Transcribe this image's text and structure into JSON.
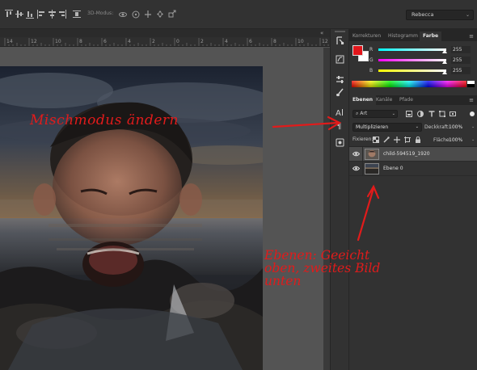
{
  "options_bar": {
    "mode_3d_label": "3D-Modus:",
    "workspace": "Rebecca",
    "icons": [
      "align-top-icon",
      "align-vcenter-icon",
      "align-bottom-icon",
      "align-left-icon",
      "align-hcenter-icon",
      "align-right-icon",
      "distribute-icon",
      "orbit-3d-icon",
      "roll-3d-icon",
      "pan-3d-icon",
      "slide-3d-icon",
      "scale-3d-icon"
    ]
  },
  "ruler": {
    "labels": [
      "14",
      "12",
      "10",
      "8",
      "6",
      "4",
      "2",
      "0",
      "2",
      "4",
      "6",
      "8",
      "10",
      "12"
    ]
  },
  "document": {
    "close_glyph": "«"
  },
  "annotations": {
    "mix_mode": "Mischmodus ändern",
    "layers_lines": [
      "Ebenen: Geeicht",
      "oben, zweites Bild",
      "unten"
    ],
    "color": "#e11b1b"
  },
  "toolstrip": {
    "icons": [
      "history-brush-icon",
      "paths-icon",
      "adjust-sliders-icon",
      "brush-settings-icon",
      "character-icon",
      "paragraph-icon",
      "properties-icon"
    ]
  },
  "color_panel": {
    "tabs": [
      "Korrekturen",
      "Histogramm",
      "Farbe"
    ],
    "active_tab": "Farbe",
    "foreground": "#e3161b",
    "background": "#ffffff",
    "channels": [
      {
        "label": "R",
        "value": "255",
        "gradient": "linear-gradient(to right, #00ffff, #ffffff)"
      },
      {
        "label": "G",
        "value": "255",
        "gradient": "linear-gradient(to right, #ff00ff, #ffffff)"
      },
      {
        "label": "B",
        "value": "255",
        "gradient": "linear-gradient(to right, #ffff00, #ffffff)"
      }
    ]
  },
  "layers_panel": {
    "tabs": [
      "Ebenen",
      "Kanäle",
      "Pfade"
    ],
    "active_tab": "Ebenen",
    "filter_kind": "Art",
    "blend_mode": "Multiplizieren",
    "opacity_label": "Deckkraft:",
    "opacity_value": "100%",
    "lock_label": "Fixieren:",
    "fill_label": "Fläche:",
    "fill_value": "100%",
    "layers": [
      {
        "name": "child-594519_1920",
        "selected": true,
        "visible": true
      },
      {
        "name": "Ebene 0",
        "selected": false,
        "visible": true
      }
    ]
  }
}
